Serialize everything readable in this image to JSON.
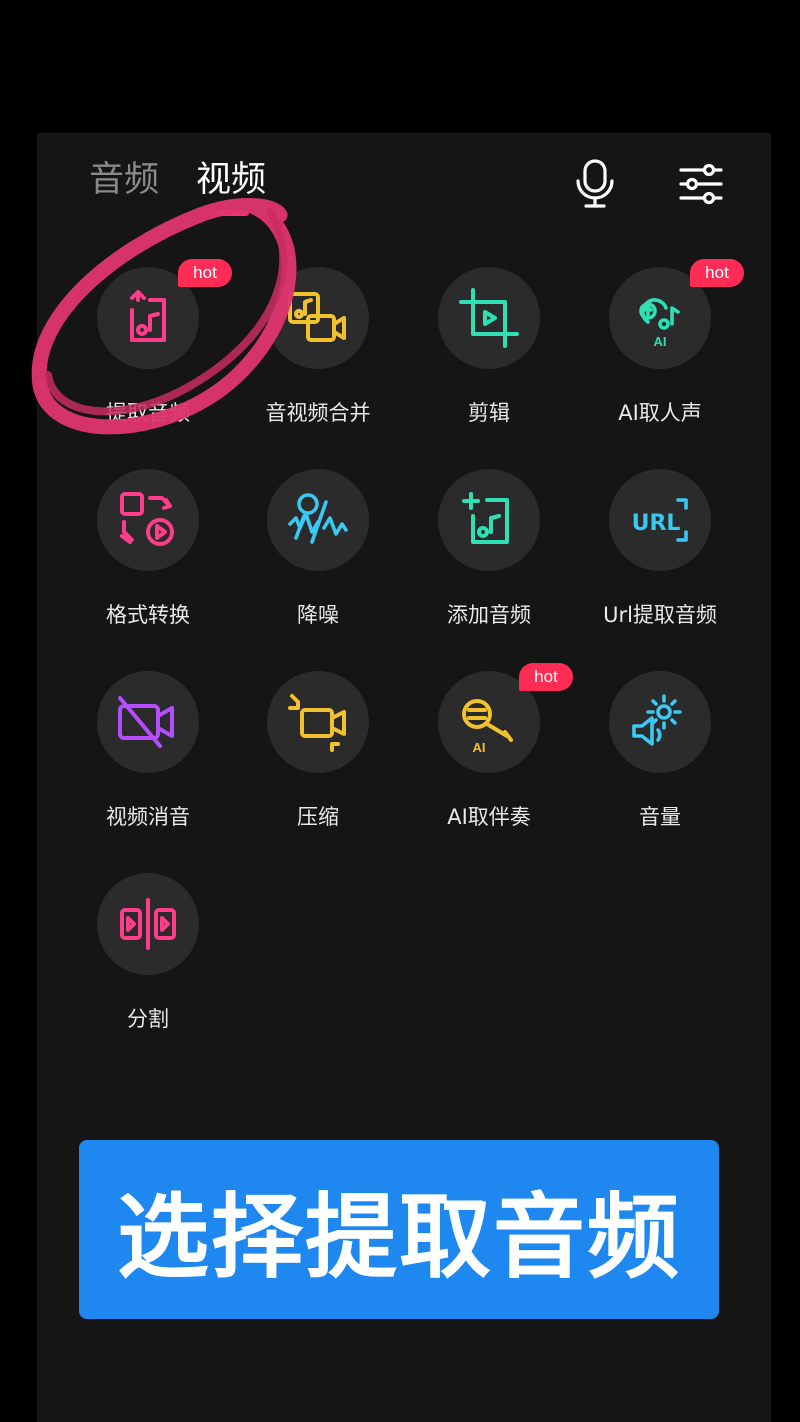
{
  "header": {
    "tab_audio": "音频",
    "tab_video": "视频",
    "mic_icon": "microphone-icon",
    "settings_icon": "sliders-icon"
  },
  "tools": [
    {
      "label": "提取音频",
      "hot": "hot",
      "icon": "extract-audio-icon",
      "color": "#ff3d8a"
    },
    {
      "label": "音视频合并",
      "icon": "merge-audio-video-icon",
      "color": "#f2c12e"
    },
    {
      "label": "剪辑",
      "icon": "crop-icon",
      "color": "#2ee0b4"
    },
    {
      "label": "AI取人声",
      "hot": "hot",
      "icon": "ai-vocal-icon",
      "color": "#2ee0b4",
      "ai": "AI"
    },
    {
      "label": "格式转换",
      "icon": "format-convert-icon",
      "color": "#ff3d8a"
    },
    {
      "label": "降噪",
      "icon": "denoise-icon",
      "color": "#3ac8f5"
    },
    {
      "label": "添加音频",
      "icon": "add-audio-icon",
      "color": "#2ee0b4"
    },
    {
      "label": "Url提取音频",
      "icon": "url-icon",
      "color": "#3ac8f5",
      "text": "URL"
    },
    {
      "label": "视频消音",
      "icon": "mute-video-icon",
      "color": "#b44dff"
    },
    {
      "label": "压缩",
      "icon": "compress-icon",
      "color": "#f2c12e"
    },
    {
      "label": "AI取伴奏",
      "hot": "hot",
      "icon": "ai-accompaniment-icon",
      "color": "#f2c12e",
      "ai": "AI"
    },
    {
      "label": "音量",
      "icon": "volume-gear-icon",
      "color": "#3ac8f5"
    },
    {
      "label": "分割",
      "icon": "split-icon",
      "color": "#ff3d8a"
    }
  ],
  "banner": {
    "text": "选择提取音频"
  },
  "colors": {
    "accent": "#ff2c55",
    "banner": "#1e88f0",
    "annotation": "#e0356f"
  }
}
